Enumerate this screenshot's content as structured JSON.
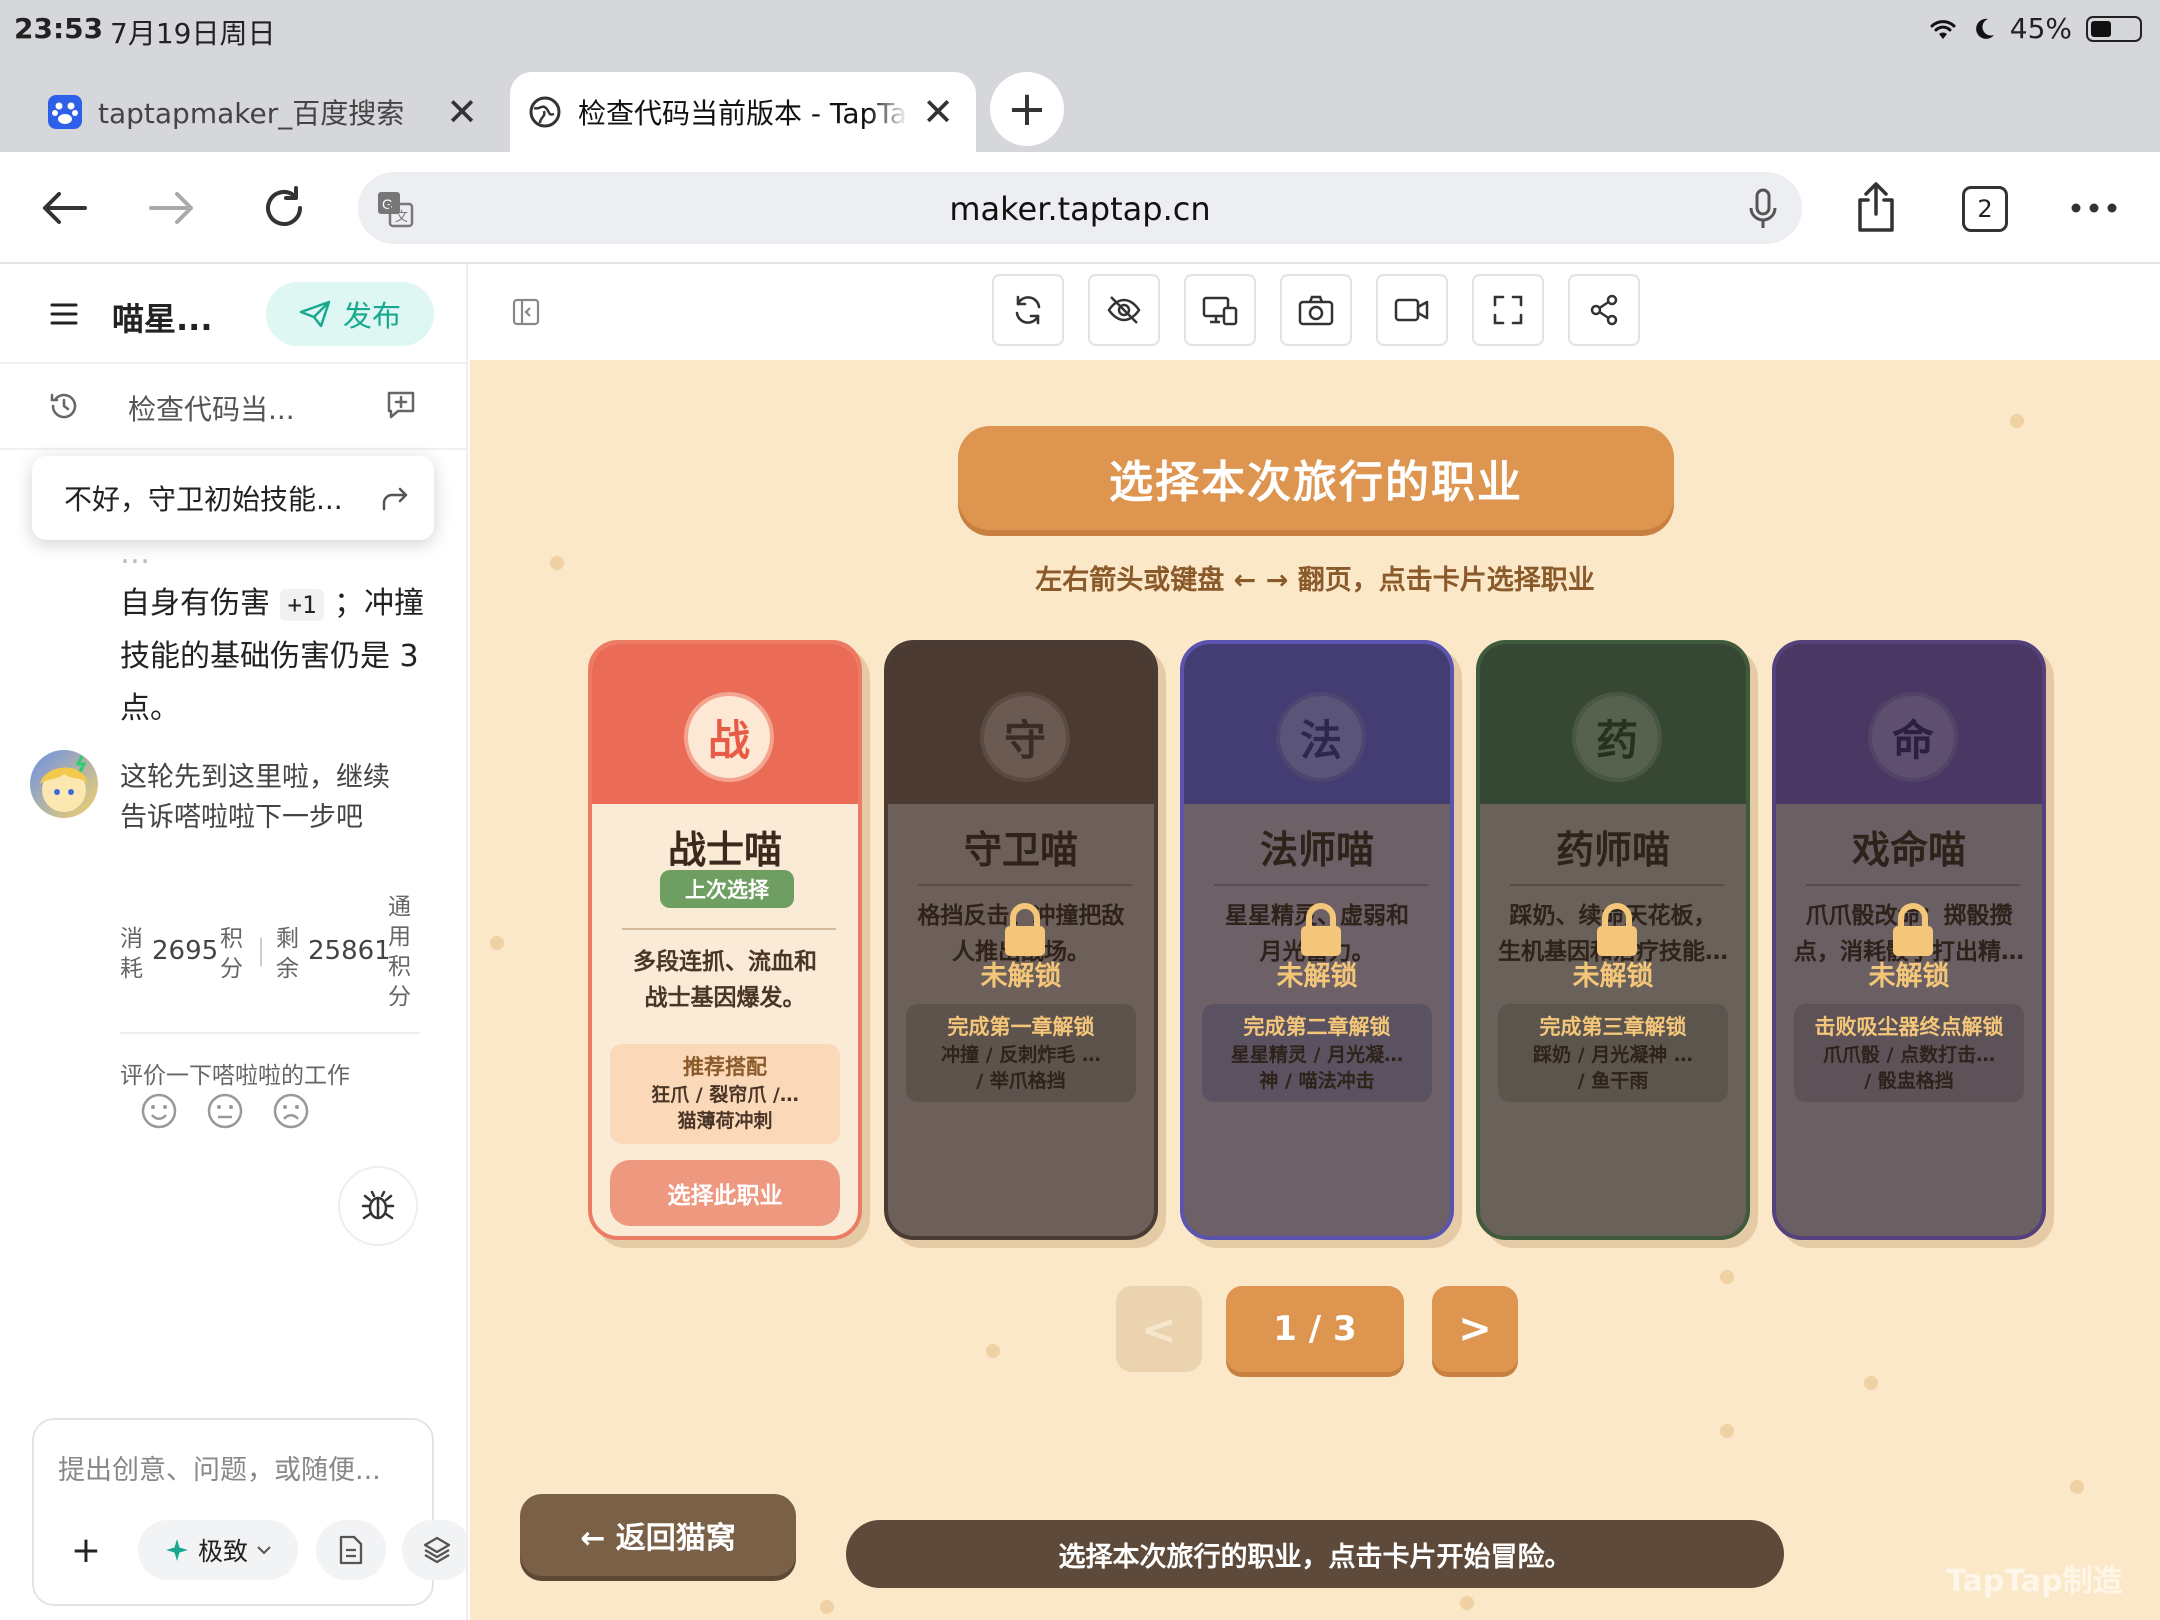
{
  "status_bar": {
    "time": "23:53",
    "date": "7月19日周日",
    "battery": "45%"
  },
  "browser": {
    "tabs": [
      {
        "title": "taptapmaker_百度搜索",
        "icon": "baidu-paw-icon"
      },
      {
        "title": "检查代码当前版本 - TapTa",
        "icon": "globe-icon"
      }
    ],
    "url": "maker.taptap.cn",
    "tab_count": "2"
  },
  "sidebar": {
    "project_title": "喵星...",
    "publish_label": "发布",
    "history_title": "检查代码当...",
    "popup_text": "不好，守卫初始技能...",
    "message_prefix": "自身有伤害",
    "message_code": "+1",
    "message_suffix": "；冲撞技能的基础伤害仍是 3 点。",
    "bot_message": "这轮先到这里啦，继续告诉嗒啦啦下一步吧",
    "stats": {
      "consume_label": "消耗",
      "consume_value": "2695",
      "consume_unit": "积分",
      "remain_label": "剩余",
      "remain_value": "25861",
      "remain_unit": "通用积分"
    },
    "feedback_label": "评价一下嗒啦啦的工作",
    "input_placeholder": "提出创意、问题，或随便...",
    "mode_label": "极致"
  },
  "game": {
    "title": "选择本次旅行的职业",
    "subtitle": "左右箭头或键盘 ← → 翻页，点击卡片选择职业",
    "cards": [
      {
        "emblem": "战",
        "name": "战士喵",
        "badge": "上次选择",
        "desc1": "多段连抓、流血和",
        "desc2": "战士基因爆发。",
        "rec_title": "推荐搭配",
        "rec1": "狂爪 / 裂帘爪 /…",
        "rec2": "猫薄荷冲刺",
        "select_label": "选择此职业"
      },
      {
        "emblem": "守",
        "name": "守卫喵",
        "desc1": "格挡反击、冲撞把敌",
        "desc2": "人推出战场。",
        "lock_label": "未解锁",
        "unlock_hint": "完成第一章解锁",
        "rec1": "冲撞 / 反刺炸毛 …",
        "rec2": "/ 举爪格挡"
      },
      {
        "emblem": "法",
        "name": "法师喵",
        "desc1": "星星精灵、虚弱和",
        "desc2": "月光蓄力。",
        "lock_label": "未解锁",
        "unlock_hint": "完成第二章解锁",
        "rec1": "星星精灵 / 月光凝…",
        "rec2": "神 / 喵法冲击"
      },
      {
        "emblem": "药",
        "name": "药师喵",
        "desc1": "踩奶、续命天花板，",
        "desc2": "生机基因和治疗技能…",
        "lock_label": "未解锁",
        "unlock_hint": "完成第三章解锁",
        "rec1": "踩奶 / 月光凝神 …",
        "rec2": "/ 鱼干雨"
      },
      {
        "emblem": "命",
        "name": "戏命喵",
        "desc1": "爪爪骰改命：掷骰攒",
        "desc2": "点，消耗骰子打出精…",
        "lock_label": "未解锁",
        "unlock_hint": "击败吸尘器终点解锁",
        "rec1": "爪爪骰 / 点数打击…",
        "rec2": "/ 骰盅格挡"
      }
    ],
    "pager": {
      "prev": "<",
      "page": "1 / 3",
      "next": ">"
    },
    "back_label": "← 返回猫窝",
    "info_text": "选择本次旅行的职业，点击卡片开始冒险。",
    "watermark": "TapTap制造"
  }
}
